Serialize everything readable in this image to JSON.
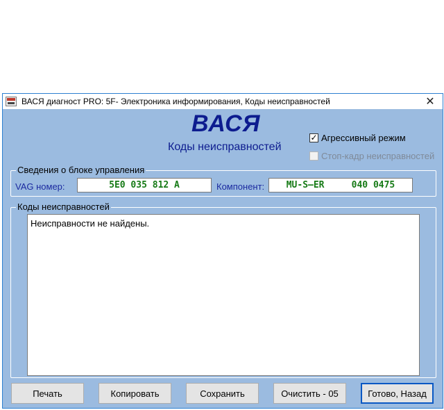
{
  "window": {
    "title": "ВАСЯ диагност PRO: 5F- Электроника информирования,  Коды неисправностей",
    "close_glyph": "✕",
    "app_icon": "app-icon"
  },
  "header": {
    "brand": "ВАСЯ",
    "subtitle": "Коды неисправностей"
  },
  "options": {
    "aggressive": {
      "label": "Агрессивный режим",
      "checked": true,
      "check_glyph": "✓"
    },
    "freeze_frame": {
      "label": "Стоп-кадр неисправностей",
      "checked": false,
      "enabled": false
    }
  },
  "control_unit": {
    "legend": "Сведения о блоке управления",
    "vag_label": "VAG номер:",
    "vag_value": "5E0 035 812 A",
    "component_label": "Компонент:",
    "component_value": "MU-S—ER     040 0475"
  },
  "fault_codes": {
    "legend": "Коды неисправностей",
    "text": "Неисправности не найдены."
  },
  "buttons": {
    "print": "Печать",
    "copy": "Копировать",
    "save": "Сохранить",
    "clear": "Очистить - 05",
    "done": "Готово, Назад"
  }
}
